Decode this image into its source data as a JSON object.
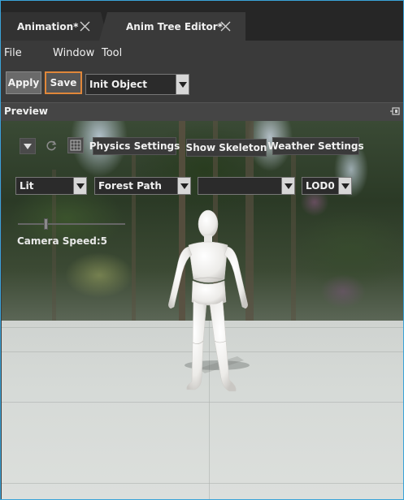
{
  "tabs": [
    {
      "label": "Animation*"
    },
    {
      "label": "Anim Tree Editor*"
    }
  ],
  "menu": [
    "File",
    "Window",
    "Tool"
  ],
  "toolbar": {
    "apply_label": "Apply",
    "save_label": "Save",
    "object_select": "Init Object"
  },
  "preview": {
    "title": "Preview",
    "buttons": {
      "physics": "Physics Settings",
      "skeleton": "Show Skeleton",
      "weather": "Weather Settings"
    },
    "selects": {
      "shading": "Lit",
      "environment": "Forest Path",
      "third": "",
      "lod": "LOD0"
    },
    "camera_speed_label": "Camera Speed:5",
    "camera_speed_value": 5
  },
  "colors": {
    "accent_border": "#3aa3d8",
    "save_highlight": "#e0873a",
    "background": "#3a3a3a"
  },
  "icons": [
    "close-icon",
    "pin-icon",
    "triangle-down-icon",
    "refresh-icon",
    "grid-icon",
    "chevron-down-icon"
  ]
}
